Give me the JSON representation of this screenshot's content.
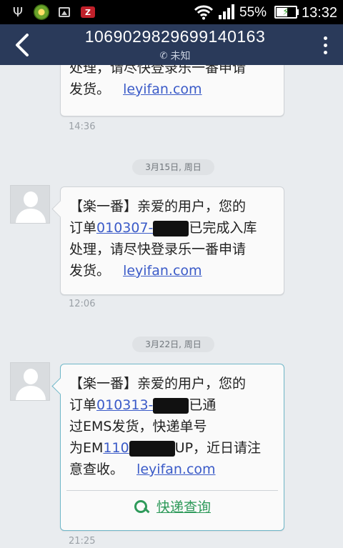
{
  "status_bar": {
    "battery_percent": "55%",
    "time": "13:32",
    "icons": [
      "usb-icon",
      "app-icon",
      "gallery-icon",
      "app-z-icon",
      "wifi-icon",
      "signal-icon",
      "battery-charging-icon"
    ]
  },
  "header": {
    "phone_number": "1069029829699140163",
    "contact_status": "未知"
  },
  "messages": [
    {
      "lines": [
        {
          "text": "处理，请尽快登录乐一番申请"
        },
        {
          "text": "发货。",
          "link": "leyifan.com"
        }
      ],
      "time": "14:36"
    },
    {
      "date": "3月15日, 周日",
      "line1": "【楽一番】亲爱的用户，您的",
      "order_prefix": "订单",
      "order_link": "010307-",
      "order_suffix": "已完成入库",
      "line3": "处理，请尽快登录乐一番申请",
      "line4_text": "发货。",
      "line4_link": "leyifan.com",
      "time": "12:06"
    },
    {
      "date": "3月22日, 周日",
      "line1": "【楽一番】亲爱的用户，您的",
      "order_prefix": "订单",
      "order_link": "010313-",
      "order_suffix": "已通",
      "line3": "过EMS发货，快递单号",
      "tracking_prefix": "为EM",
      "tracking_link": "110",
      "tracking_suffix": "UP，近日请注",
      "line5_text": "意查收。",
      "line5_link": "leyifan.com",
      "action_label": "快递查询",
      "time": "21:25"
    }
  ],
  "colors": {
    "action_bar": "#2a3a5a",
    "link": "#3b5bc8",
    "action_green": "#2e9a5a",
    "background": "#e9ecef"
  }
}
